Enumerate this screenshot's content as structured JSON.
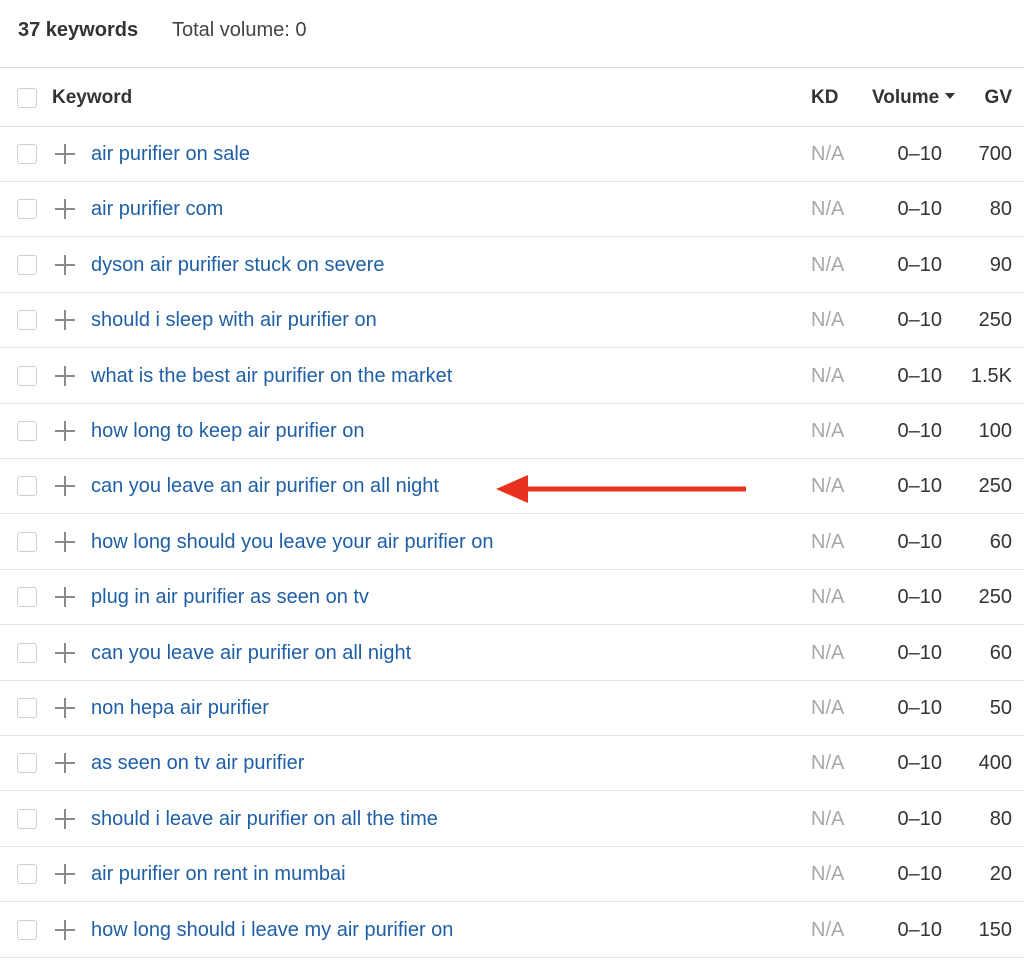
{
  "summary": {
    "keyword_count": "37 keywords",
    "total_volume": "Total volume: 0"
  },
  "table": {
    "columns": {
      "keyword": "Keyword",
      "kd": "KD",
      "volume": "Volume",
      "gv": "GV"
    },
    "sort": {
      "column": "Volume",
      "direction": "descending"
    },
    "rows": [
      {
        "keyword": "air purifier on sale",
        "kd": "N/A",
        "volume": "0–10",
        "gv": "700"
      },
      {
        "keyword": "air purifier com",
        "kd": "N/A",
        "volume": "0–10",
        "gv": "80"
      },
      {
        "keyword": "dyson air purifier stuck on severe",
        "kd": "N/A",
        "volume": "0–10",
        "gv": "90"
      },
      {
        "keyword": "should i sleep with air purifier on",
        "kd": "N/A",
        "volume": "0–10",
        "gv": "250"
      },
      {
        "keyword": "what is the best air purifier on the market",
        "kd": "N/A",
        "volume": "0–10",
        "gv": "1.5K"
      },
      {
        "keyword": "how long to keep air purifier on",
        "kd": "N/A",
        "volume": "0–10",
        "gv": "100"
      },
      {
        "keyword": "can you leave an air purifier on all night",
        "kd": "N/A",
        "volume": "0–10",
        "gv": "250"
      },
      {
        "keyword": "how long should you leave your air purifier on",
        "kd": "N/A",
        "volume": "0–10",
        "gv": "60"
      },
      {
        "keyword": "plug in air purifier as seen on tv",
        "kd": "N/A",
        "volume": "0–10",
        "gv": "250"
      },
      {
        "keyword": "can you leave air purifier on all night",
        "kd": "N/A",
        "volume": "0–10",
        "gv": "60"
      },
      {
        "keyword": "non hepa air purifier",
        "kd": "N/A",
        "volume": "0–10",
        "gv": "50"
      },
      {
        "keyword": "as seen on tv air purifier",
        "kd": "N/A",
        "volume": "0–10",
        "gv": "400"
      },
      {
        "keyword": "should i leave air purifier on all the time",
        "kd": "N/A",
        "volume": "0–10",
        "gv": "80"
      },
      {
        "keyword": "air purifier on rent in mumbai",
        "kd": "N/A",
        "volume": "0–10",
        "gv": "20"
      },
      {
        "keyword": "how long should i leave my air purifier on",
        "kd": "N/A",
        "volume": "0–10",
        "gv": "150"
      }
    ]
  },
  "annotation": {
    "type": "arrow",
    "color": "#e8321e",
    "points_to_row": 7
  },
  "colors": {
    "keyword_link": "#1f5fa6",
    "na_text": "#a8a8a8",
    "divider": "#dcdcdc"
  }
}
